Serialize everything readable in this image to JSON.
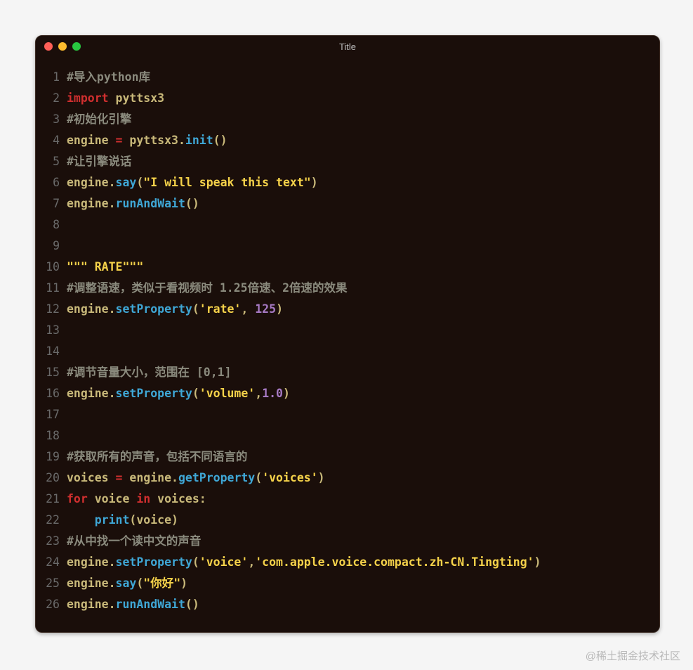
{
  "window": {
    "title": "Title"
  },
  "watermark": "@稀土掘金技术社区",
  "lines": [
    {
      "n": 1,
      "tokens": [
        {
          "t": "#导入python库",
          "c": "comment"
        }
      ]
    },
    {
      "n": 2,
      "tokens": [
        {
          "t": "import",
          "c": "keyword"
        },
        {
          "t": " ",
          "c": "punct"
        },
        {
          "t": "pyttsx3",
          "c": "var"
        }
      ]
    },
    {
      "n": 3,
      "tokens": [
        {
          "t": "#初始化引擎",
          "c": "comment"
        }
      ]
    },
    {
      "n": 4,
      "tokens": [
        {
          "t": "engine",
          "c": "var"
        },
        {
          "t": " ",
          "c": "punct"
        },
        {
          "t": "=",
          "c": "op"
        },
        {
          "t": " ",
          "c": "punct"
        },
        {
          "t": "pyttsx3",
          "c": "var"
        },
        {
          "t": ".",
          "c": "punct"
        },
        {
          "t": "init",
          "c": "func"
        },
        {
          "t": "()",
          "c": "punct"
        }
      ]
    },
    {
      "n": 5,
      "tokens": [
        {
          "t": "#让引擎说话",
          "c": "comment"
        }
      ]
    },
    {
      "n": 6,
      "tokens": [
        {
          "t": "engine",
          "c": "var"
        },
        {
          "t": ".",
          "c": "punct"
        },
        {
          "t": "say",
          "c": "func"
        },
        {
          "t": "(",
          "c": "punct"
        },
        {
          "t": "\"I will speak this text\"",
          "c": "string"
        },
        {
          "t": ")",
          "c": "punct"
        }
      ]
    },
    {
      "n": 7,
      "tokens": [
        {
          "t": "engine",
          "c": "var"
        },
        {
          "t": ".",
          "c": "punct"
        },
        {
          "t": "runAndWait",
          "c": "func"
        },
        {
          "t": "()",
          "c": "punct"
        }
      ]
    },
    {
      "n": 8,
      "tokens": []
    },
    {
      "n": 9,
      "tokens": []
    },
    {
      "n": 10,
      "tokens": [
        {
          "t": "\"\"\" RATE\"\"\"",
          "c": "string"
        }
      ]
    },
    {
      "n": 11,
      "tokens": [
        {
          "t": "#调整语速，类似于看视频时 1.25倍速、2倍速的效果",
          "c": "comment"
        }
      ]
    },
    {
      "n": 12,
      "tokens": [
        {
          "t": "engine",
          "c": "var"
        },
        {
          "t": ".",
          "c": "punct"
        },
        {
          "t": "setProperty",
          "c": "func"
        },
        {
          "t": "(",
          "c": "punct"
        },
        {
          "t": "'rate'",
          "c": "string"
        },
        {
          "t": ", ",
          "c": "punct"
        },
        {
          "t": "125",
          "c": "num"
        },
        {
          "t": ")",
          "c": "punct"
        }
      ]
    },
    {
      "n": 13,
      "tokens": []
    },
    {
      "n": 14,
      "tokens": []
    },
    {
      "n": 15,
      "tokens": [
        {
          "t": "#调节音量大小，范围在 [0,1]",
          "c": "comment"
        }
      ]
    },
    {
      "n": 16,
      "tokens": [
        {
          "t": "engine",
          "c": "var"
        },
        {
          "t": ".",
          "c": "punct"
        },
        {
          "t": "setProperty",
          "c": "func"
        },
        {
          "t": "(",
          "c": "punct"
        },
        {
          "t": "'volume'",
          "c": "string"
        },
        {
          "t": ",",
          "c": "punct"
        },
        {
          "t": "1.0",
          "c": "num"
        },
        {
          "t": ")",
          "c": "punct"
        }
      ]
    },
    {
      "n": 17,
      "tokens": []
    },
    {
      "n": 18,
      "tokens": []
    },
    {
      "n": 19,
      "tokens": [
        {
          "t": "#获取所有的声音，包括不同语言的",
          "c": "comment"
        }
      ]
    },
    {
      "n": 20,
      "tokens": [
        {
          "t": "voices",
          "c": "var"
        },
        {
          "t": " ",
          "c": "punct"
        },
        {
          "t": "=",
          "c": "op"
        },
        {
          "t": " ",
          "c": "punct"
        },
        {
          "t": "engine",
          "c": "var"
        },
        {
          "t": ".",
          "c": "punct"
        },
        {
          "t": "getProperty",
          "c": "func"
        },
        {
          "t": "(",
          "c": "punct"
        },
        {
          "t": "'voices'",
          "c": "string"
        },
        {
          "t": ")",
          "c": "punct"
        }
      ]
    },
    {
      "n": 21,
      "tokens": [
        {
          "t": "for",
          "c": "keyword"
        },
        {
          "t": " ",
          "c": "punct"
        },
        {
          "t": "voice",
          "c": "var"
        },
        {
          "t": " ",
          "c": "punct"
        },
        {
          "t": "in",
          "c": "keyword"
        },
        {
          "t": " ",
          "c": "punct"
        },
        {
          "t": "voices",
          "c": "var"
        },
        {
          "t": ":",
          "c": "punct"
        }
      ]
    },
    {
      "n": 22,
      "tokens": [
        {
          "t": "    ",
          "c": "punct"
        },
        {
          "t": "print",
          "c": "builtin"
        },
        {
          "t": "(",
          "c": "punct"
        },
        {
          "t": "voice",
          "c": "var"
        },
        {
          "t": ")",
          "c": "punct"
        }
      ]
    },
    {
      "n": 23,
      "tokens": [
        {
          "t": "#从中找一个读中文的声音",
          "c": "comment"
        }
      ]
    },
    {
      "n": 24,
      "tokens": [
        {
          "t": "engine",
          "c": "var"
        },
        {
          "t": ".",
          "c": "punct"
        },
        {
          "t": "setProperty",
          "c": "func"
        },
        {
          "t": "(",
          "c": "punct"
        },
        {
          "t": "'voice'",
          "c": "string"
        },
        {
          "t": ",",
          "c": "punct"
        },
        {
          "t": "'com.apple.voice.compact.zh-CN.Tingting'",
          "c": "string"
        },
        {
          "t": ")",
          "c": "punct"
        }
      ]
    },
    {
      "n": 25,
      "tokens": [
        {
          "t": "engine",
          "c": "var"
        },
        {
          "t": ".",
          "c": "punct"
        },
        {
          "t": "say",
          "c": "func"
        },
        {
          "t": "(",
          "c": "punct"
        },
        {
          "t": "\"你好\"",
          "c": "string"
        },
        {
          "t": ")",
          "c": "punct"
        }
      ]
    },
    {
      "n": 26,
      "tokens": [
        {
          "t": "engine",
          "c": "var"
        },
        {
          "t": ".",
          "c": "punct"
        },
        {
          "t": "runAndWait",
          "c": "func"
        },
        {
          "t": "()",
          "c": "punct"
        }
      ]
    }
  ]
}
